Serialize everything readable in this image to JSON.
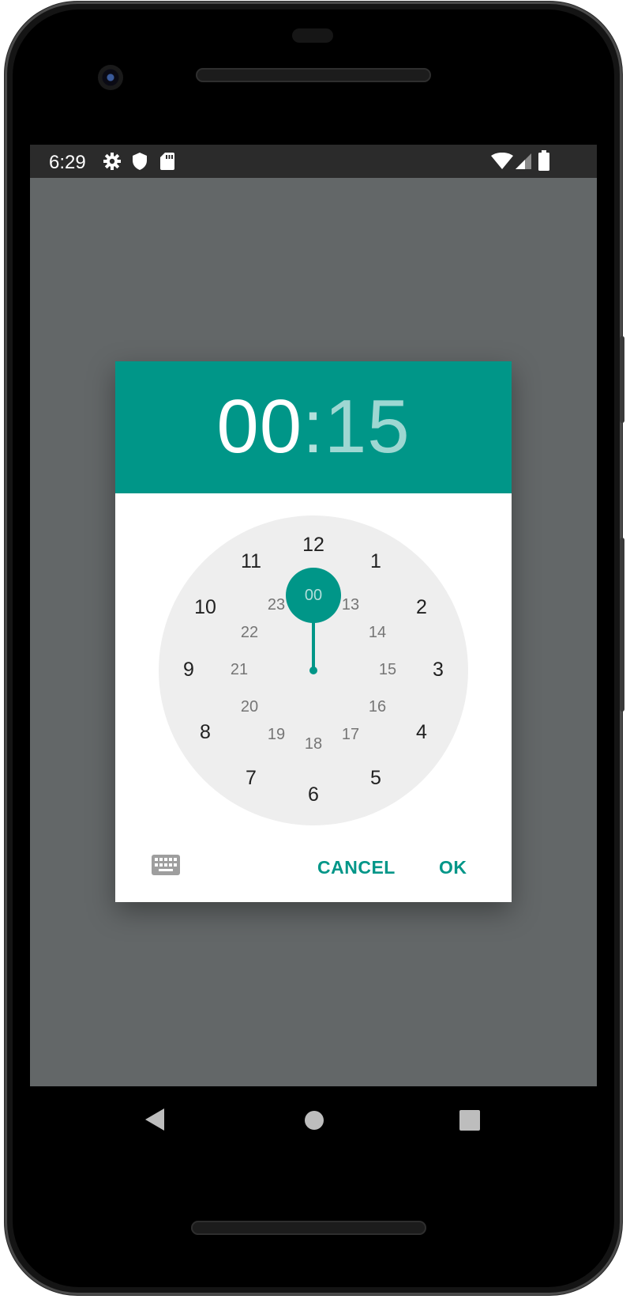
{
  "status_bar": {
    "time": "6:29",
    "left_icons": [
      "settings-icon",
      "shield-icon",
      "sd-card-icon"
    ],
    "right_icons": [
      "wifi-icon",
      "cell-signal-icon",
      "battery-icon"
    ]
  },
  "dialog": {
    "hour": "00",
    "separator": ":",
    "minute": "15",
    "accent_color": "#009688",
    "clock": {
      "outer_ring": [
        "12",
        "1",
        "2",
        "3",
        "4",
        "5",
        "6",
        "7",
        "8",
        "9",
        "10",
        "11"
      ],
      "inner_ring": [
        "00",
        "13",
        "14",
        "15",
        "16",
        "17",
        "18",
        "19",
        "20",
        "21",
        "22",
        "23"
      ],
      "selected": "00"
    },
    "cancel_label": "CANCEL",
    "ok_label": "OK",
    "mode_toggle_icon": "keyboard-icon"
  },
  "nav_bar": {
    "icons": [
      "back-icon",
      "home-icon",
      "recents-icon"
    ]
  }
}
